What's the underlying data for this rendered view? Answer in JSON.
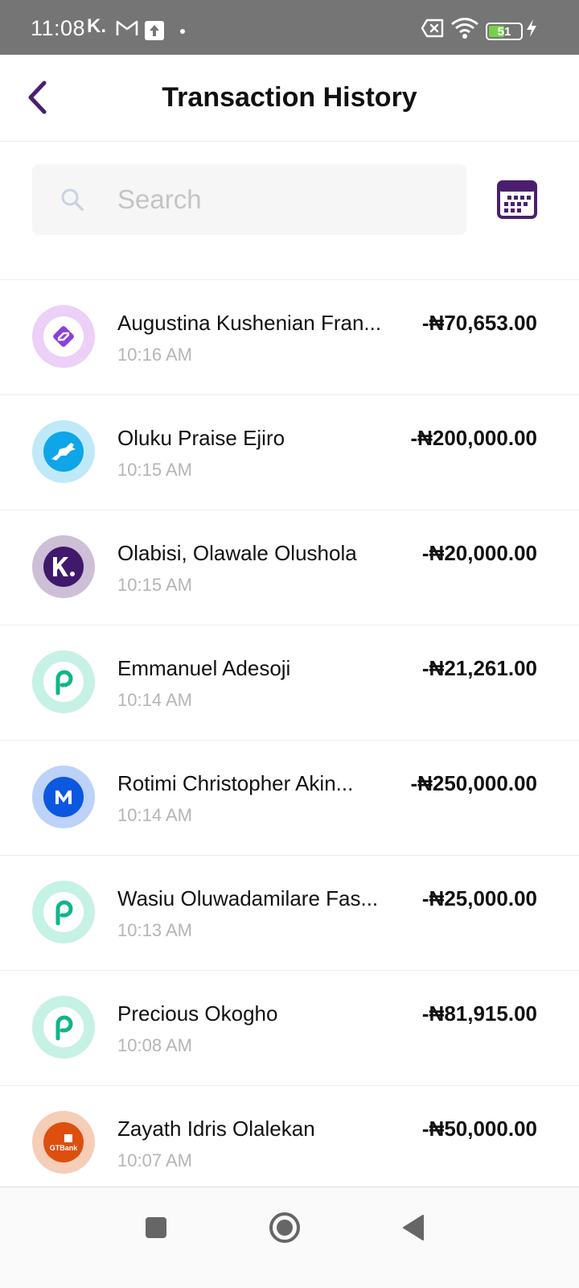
{
  "status_bar": {
    "time": "11:08",
    "kuda_glyph": "K.",
    "battery": "51",
    "battery_level": 0.51,
    "icons": [
      "kuda-icon",
      "gmail-icon",
      "upload-icon",
      "dot-icon",
      "sim-off-icon",
      "wifi-icon",
      "battery-icon",
      "charging-icon"
    ]
  },
  "header": {
    "title": "Transaction History",
    "back_icon": "chevron-left-icon"
  },
  "search": {
    "placeholder": "Search",
    "value": "",
    "calendar_icon": "calendar-icon"
  },
  "colors": {
    "accent": "#4b1f6f",
    "status_bar_bg": "#757575",
    "muted_text": "#b5b5b5"
  },
  "transactions": [
    {
      "name": "Augustina Kushenian Fran...",
      "time": "10:16 AM",
      "amount": "-₦70,653.00",
      "logo": "bank-logo-purple-icon",
      "ring": "#ecd0f7",
      "fill": "#ffffff"
    },
    {
      "name": "Oluku Praise Ejiro",
      "time": "10:15 AM",
      "amount": "-₦200,000.00",
      "logo": "horse-logo-icon",
      "ring": "#bfe9f8",
      "fill": "#0ea5e9"
    },
    {
      "name": "Olabisi, Olawale Olushola",
      "time": "10:15 AM",
      "amount": "-₦20,000.00",
      "logo": "kuda-logo-icon",
      "ring": "#cdbfd6",
      "fill": "#40196d"
    },
    {
      "name": "Emmanuel Adesoji",
      "time": "10:14 AM",
      "amount": "-₦21,261.00",
      "logo": "palmpay-logo-icon",
      "ring": "#c6f1e5",
      "fill": "#ffffff"
    },
    {
      "name": "Rotimi Christopher Akin...",
      "time": "10:14 AM",
      "amount": "-₦250,000.00",
      "logo": "moniepoint-logo-icon",
      "ring": "#bcd2f9",
      "fill": "#0b57e0"
    },
    {
      "name": "Wasiu Oluwadamilare Fas...",
      "time": "10:13 AM",
      "amount": "-₦25,000.00",
      "logo": "palmpay-logo-icon",
      "ring": "#c6f1e5",
      "fill": "#ffffff"
    },
    {
      "name": "Precious Okogho",
      "time": "10:08 AM",
      "amount": "-₦81,915.00",
      "logo": "palmpay-logo-icon",
      "ring": "#c6f1e5",
      "fill": "#ffffff"
    },
    {
      "name": "Zayath Idris Olalekan",
      "time": "10:07 AM",
      "amount": "-₦50,000.00",
      "logo": "gtbank-logo-icon",
      "ring": "#f6cdb7",
      "fill": "#dd4f0e",
      "logo_text": "GTBank"
    }
  ],
  "nav_bar": {
    "buttons": [
      "recents-icon",
      "home-icon",
      "back-triangle-icon"
    ]
  }
}
